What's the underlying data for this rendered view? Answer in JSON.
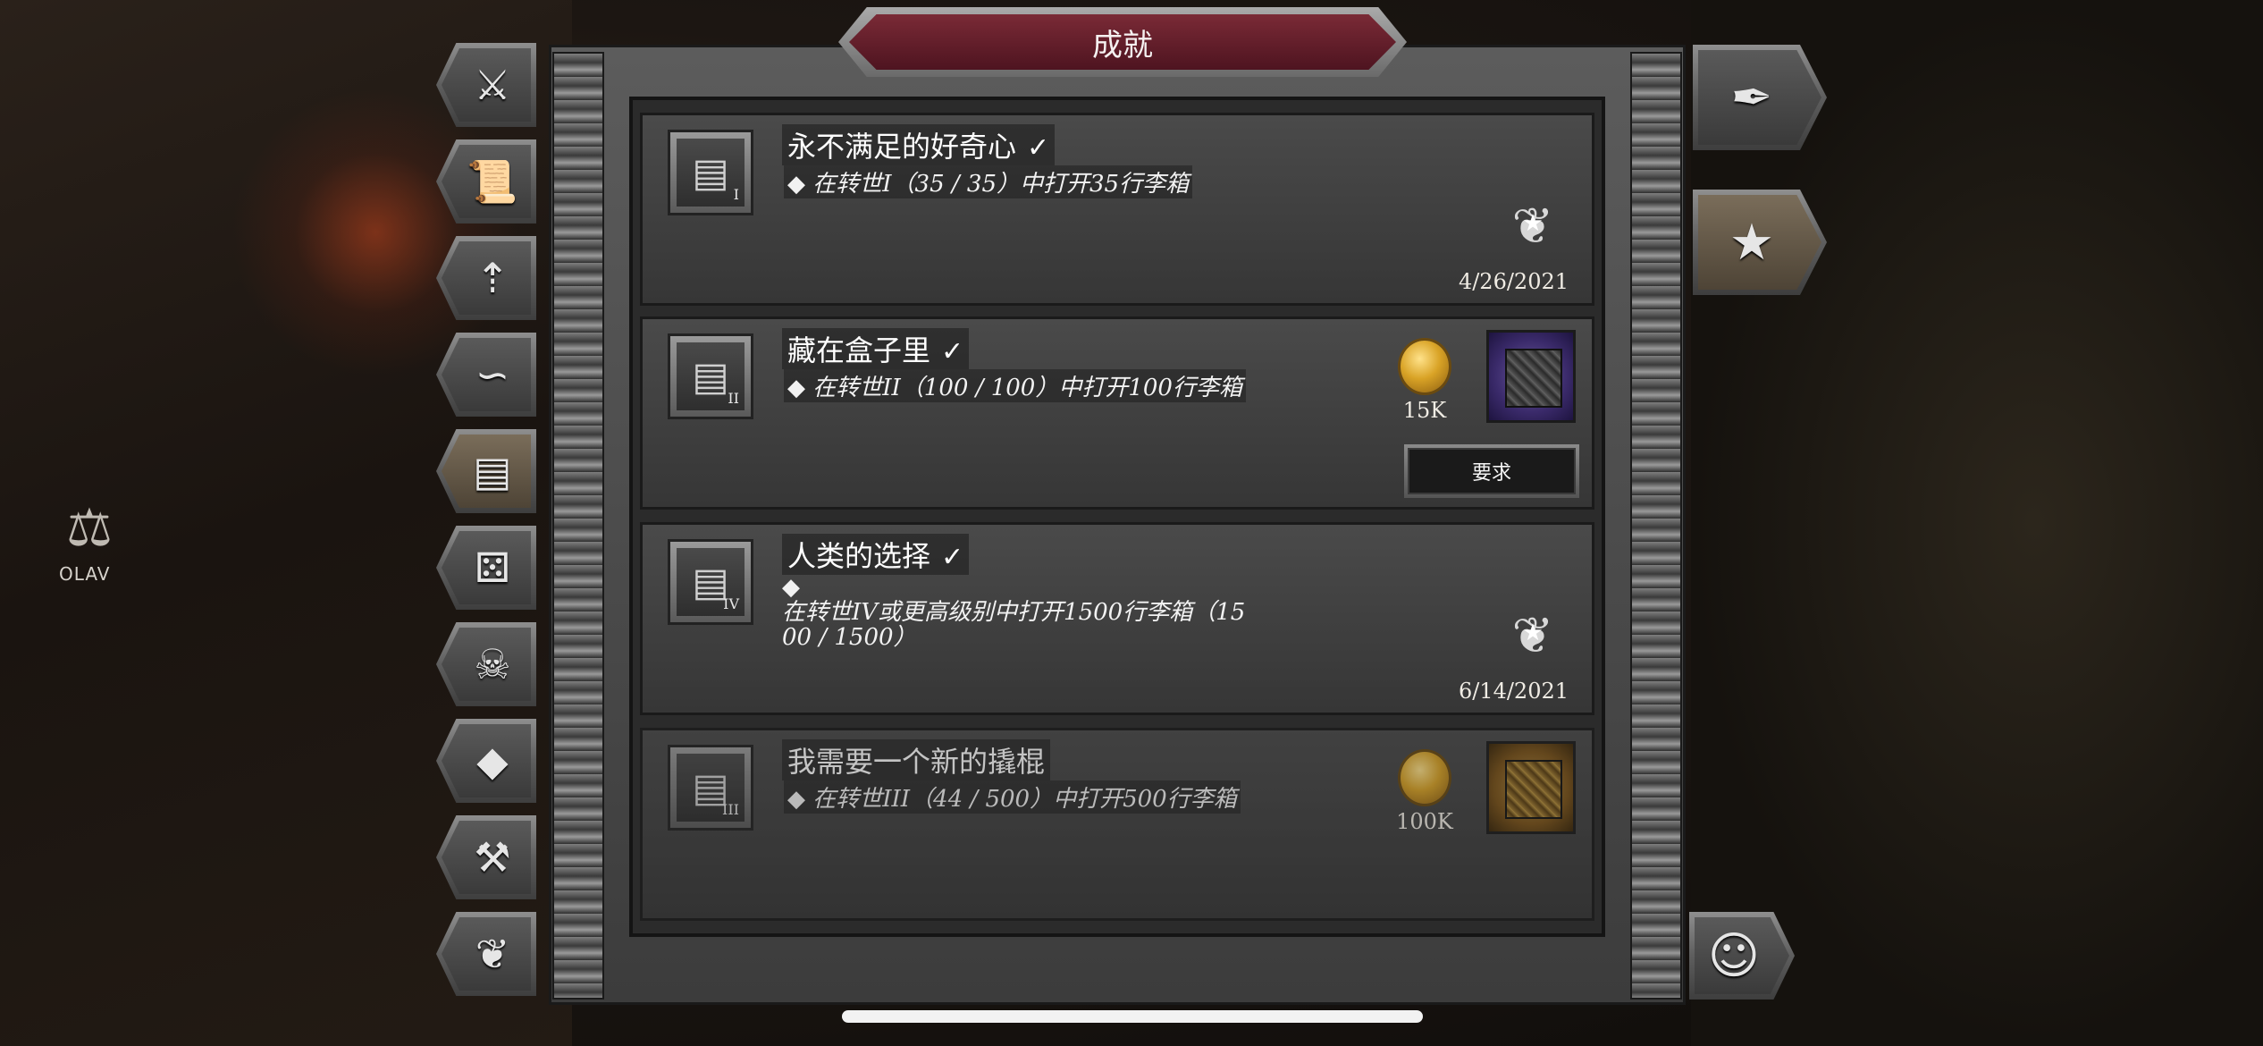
{
  "header": {
    "title": "成就"
  },
  "background": {
    "npc_name": "OLAV"
  },
  "side_tabs": [
    {
      "name": "weapons-tab",
      "icon": "sword-shield-icon",
      "glyph": "⚔"
    },
    {
      "name": "scroll-tab",
      "icon": "scroll-icon",
      "glyph": "📜"
    },
    {
      "name": "wings-tab",
      "icon": "winged-arrow-icon",
      "glyph": "⇡"
    },
    {
      "name": "serpent-tab",
      "icon": "serpent-icon",
      "glyph": "∽"
    },
    {
      "name": "chest-tab",
      "icon": "chest-icon",
      "glyph": "▤",
      "active": true
    },
    {
      "name": "dice-tab",
      "icon": "dice-icon",
      "glyph": "⚄"
    },
    {
      "name": "demon-tab",
      "icon": "demon-skull-icon",
      "glyph": "☠"
    },
    {
      "name": "gem-tab",
      "icon": "diamond-icon",
      "glyph": "◆"
    },
    {
      "name": "crafting-tab",
      "icon": "hammer-icon",
      "glyph": "⚒"
    },
    {
      "name": "paw-tab",
      "icon": "paw-icon",
      "glyph": "❦"
    }
  ],
  "right_tabs": [
    {
      "name": "quill-tab",
      "icon": "quill-icon",
      "glyph": "✒"
    },
    {
      "name": "achievements-tab",
      "icon": "laurel-star-icon",
      "glyph": "★",
      "active": true
    },
    {
      "name": "community-tab",
      "icon": "group-icon",
      "glyph": "☺"
    }
  ],
  "achievements": [
    {
      "title": "永不满足的好奇心",
      "check": "✓",
      "numeral": "I",
      "desc": "◆ 在转世I（35 / 35）中打开35行李箱",
      "date": "4/26/2021",
      "completed": true
    },
    {
      "title": "藏在盒子里",
      "check": "✓",
      "numeral": "II",
      "desc": "◆ 在转世II（100 / 100）中打开100行李箱",
      "gold_amount": "15K",
      "request_label": "要求",
      "completed": true
    },
    {
      "title": "人类的选择",
      "check": "✓",
      "numeral": "IV",
      "desc_bullet": "◆",
      "desc_line1": "在转世IV或更高级别中打开1500行李箱（15",
      "desc_line2": "00 / 1500）",
      "date": "6/14/2021",
      "completed": true
    },
    {
      "title": "我需要一个新的撬棍",
      "numeral": "III",
      "desc": "◆ 在转世III（44 / 500）中打开500行李箱",
      "gold_amount": "100K",
      "completed": false
    }
  ]
}
